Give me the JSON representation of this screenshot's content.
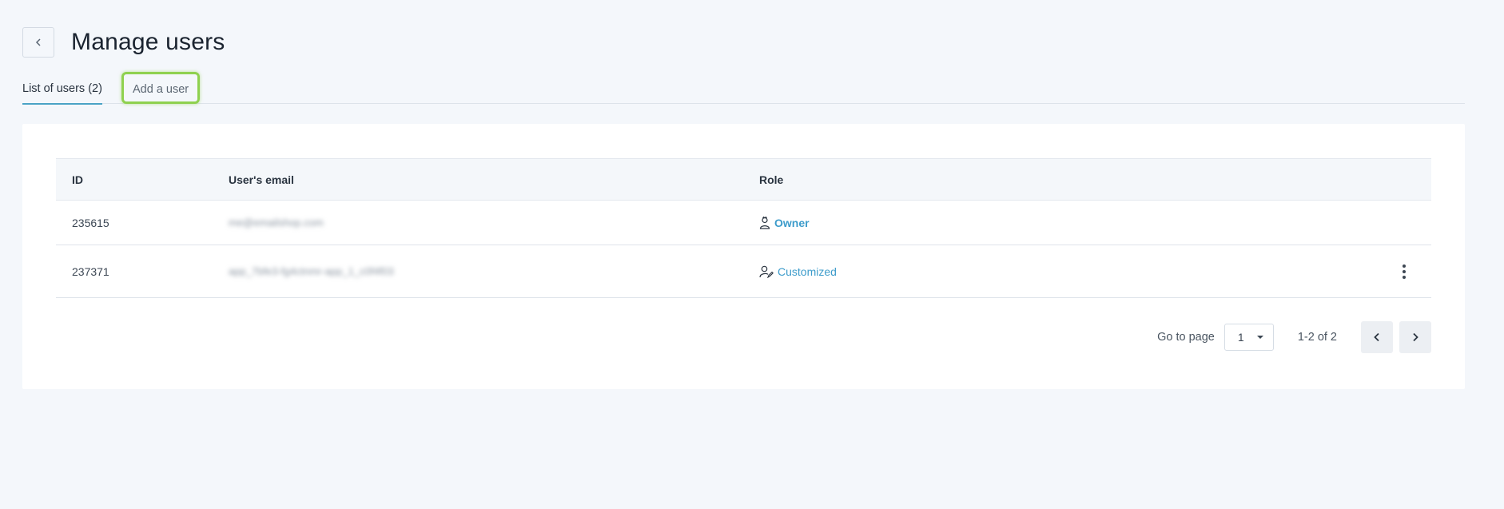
{
  "header": {
    "title": "Manage users"
  },
  "tabs": [
    {
      "label": "List of users (2)"
    },
    {
      "label": "Add a user"
    }
  ],
  "table": {
    "columns": [
      "ID",
      "User's email",
      "Role"
    ],
    "rows": [
      {
        "id": "235615",
        "email": "me@emailshop.com",
        "role": "Owner"
      },
      {
        "id": "237371",
        "email": "app_7bfe3-fg4ctnmr-app_1_c0f4f03",
        "role": "Customized"
      }
    ]
  },
  "pagination": {
    "goto_label": "Go to page",
    "selected_page": "1",
    "range": "1-2 of 2"
  },
  "colors": {
    "accent": "#4aa3c6",
    "link": "#3d9ccb",
    "highlight": "#8fd14f"
  }
}
